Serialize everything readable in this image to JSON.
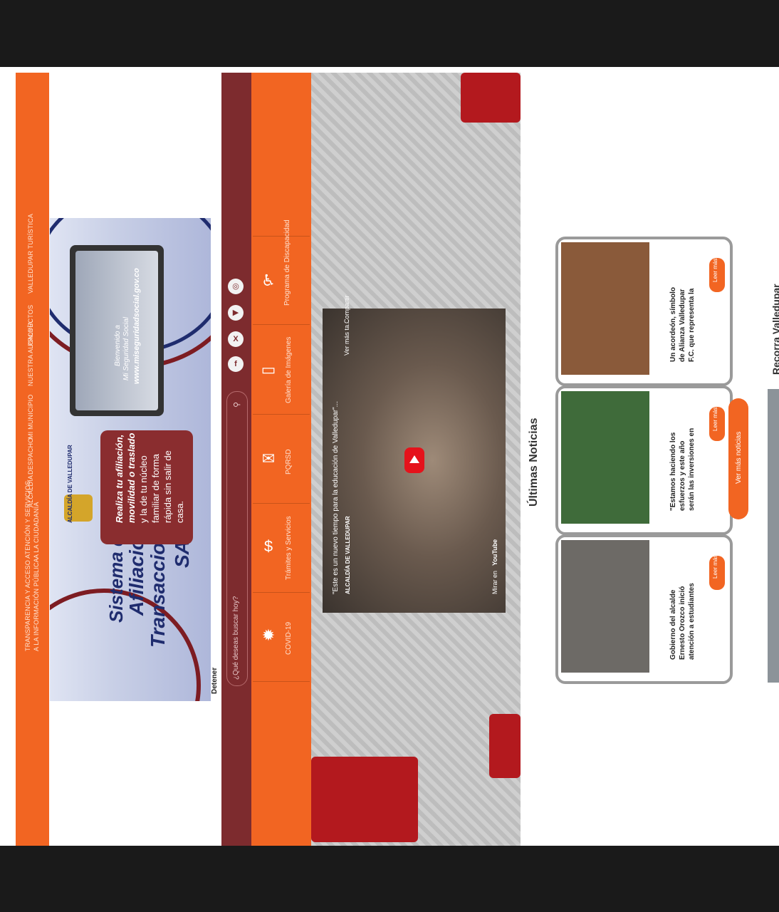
{
  "nav": {
    "items": [
      "TRANSPARENCIA Y ACCESO",
      "A LA INFORMACIÓN PÚBLICA",
      "ATENCIÓN Y SERVICIOS",
      "A LA CIUDADANÍA",
      "ALCALDÍA",
      "DESPACHO",
      "MI MUNICIPIO",
      "NUESTRA ALCALDÍA",
      "PROYECTOS",
      "VALLEDUPAR TURÍSTICA"
    ]
  },
  "banner": {
    "title_lines": [
      "Sistema de",
      "Afiliación",
      "Transaccional",
      "SAT"
    ],
    "logo_text": "ALCALDÍA DE VALLEDUPAR",
    "message_lines": [
      "Realiza tu afiliación,",
      "movilidad o traslado",
      "y la de tu núcleo",
      "familiar de forma",
      "rápida sin salir de",
      "casa."
    ],
    "screen_lines": [
      "Bienvenido a",
      "Mi Seguridad Social"
    ],
    "url": "www.miseguridadsocial.gov.co"
  },
  "detener": "Detener",
  "search": {
    "placeholder": "¿Qué deseas buscar hoy?"
  },
  "social": [
    {
      "name": "facebook-icon",
      "glyph": "f"
    },
    {
      "name": "x-icon",
      "glyph": "X"
    },
    {
      "name": "youtube-icon",
      "glyph": "▶"
    },
    {
      "name": "instagram-icon",
      "glyph": "◎"
    }
  ],
  "quick_links": [
    {
      "label": "COVID-19",
      "icon": "✹"
    },
    {
      "label": "Trámites y Servicios",
      "icon": "$"
    },
    {
      "label": "PQRSD",
      "icon": "✉"
    },
    {
      "label": "Galería de Imágenes",
      "icon": "▭"
    },
    {
      "label": "Programa de Discapacidad",
      "icon": "♿"
    }
  ],
  "video": {
    "title": "\"Este es un nuevo tiempo para la educación de Valledupar\"...",
    "channel": "ALCALDÍA DE VALLEDUPAR",
    "watch_later": "Ver más ta...",
    "share": "Compartir",
    "watch_on": "Mirar en",
    "youtube": "YouTube"
  },
  "news": {
    "title": "Últimas Noticias",
    "cards": [
      {
        "headline": [
          "Gobierno del alcalde",
          "Ernesto Orozco inició",
          "atención a estudiantes"
        ],
        "button": "Leer más",
        "color": "#6d6a66"
      },
      {
        "headline": [
          "\"Estamos haciendo los",
          "esfuerzos y este año",
          "serán las inversiones en"
        ],
        "button": "Leer más",
        "color": "#3f6b3a"
      },
      {
        "headline": [
          "Un acordeón, símbolo",
          "de Alianza Valledupar",
          "F.C. que representa la"
        ],
        "button": "Leer más",
        "color": "#8a5a3a"
      }
    ],
    "more": "Ver más noticias"
  },
  "recorra": "Recorra Valledupar"
}
